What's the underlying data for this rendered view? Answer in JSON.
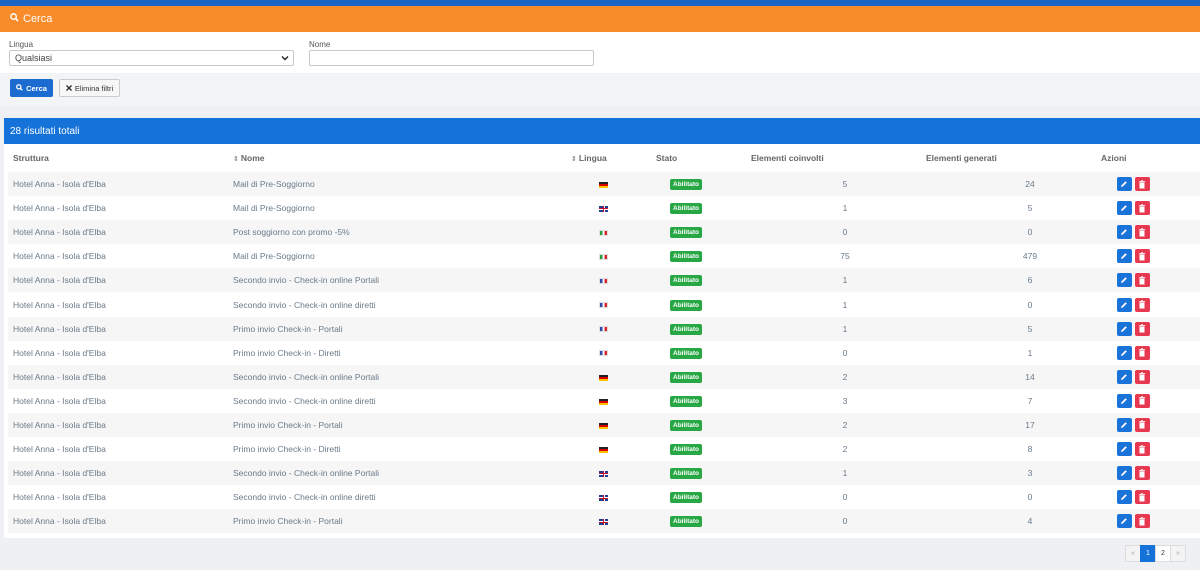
{
  "search": {
    "title": "Cerca",
    "lang_label": "Lingua",
    "lang_value": "Qualsiasi",
    "name_label": "Nome",
    "name_value": "",
    "search_button": "Cerca",
    "clear_button": "Elimina filtri"
  },
  "results": {
    "summary": "28 risultati totali",
    "columns": [
      "Struttura",
      "Nome",
      "Lingua",
      "Stato",
      "Elementi coinvolti",
      "Elementi generati",
      "Azioni"
    ],
    "rows": [
      {
        "struttura": "Hotel Anna - Isola d'Elba",
        "nome": "Mail di Pre-Soggiorno",
        "lingua": "de",
        "stato": "Abilitato",
        "coinvolti": "5",
        "generati": "24"
      },
      {
        "struttura": "Hotel Anna - Isola d'Elba",
        "nome": "Mail di Pre-Soggiorno",
        "lingua": "gb",
        "stato": "Abilitato",
        "coinvolti": "1",
        "generati": "5"
      },
      {
        "struttura": "Hotel Anna - Isola d'Elba",
        "nome": "Post soggiorno con promo -5%",
        "lingua": "it",
        "stato": "Abilitato",
        "coinvolti": "0",
        "generati": "0"
      },
      {
        "struttura": "Hotel Anna - Isola d'Elba",
        "nome": "Mail di Pre-Soggiorno",
        "lingua": "it",
        "stato": "Abilitato",
        "coinvolti": "75",
        "generati": "479"
      },
      {
        "struttura": "Hotel Anna - Isola d'Elba",
        "nome": "Secondo invio - Check-in online Portali",
        "lingua": "fr",
        "stato": "Abilitato",
        "coinvolti": "1",
        "generati": "6"
      },
      {
        "struttura": "Hotel Anna - Isola d'Elba",
        "nome": "Secondo invio - Check-in online diretti",
        "lingua": "fr",
        "stato": "Abilitato",
        "coinvolti": "1",
        "generati": "0"
      },
      {
        "struttura": "Hotel Anna - Isola d'Elba",
        "nome": "Primo invio Check-in - Portali",
        "lingua": "fr",
        "stato": "Abilitato",
        "coinvolti": "1",
        "generati": "5"
      },
      {
        "struttura": "Hotel Anna - Isola d'Elba",
        "nome": "Primo invio Check-in - Diretti",
        "lingua": "fr",
        "stato": "Abilitato",
        "coinvolti": "0",
        "generati": "1"
      },
      {
        "struttura": "Hotel Anna - Isola d'Elba",
        "nome": "Secondo invio - Check-in online Portali",
        "lingua": "de",
        "stato": "Abilitato",
        "coinvolti": "2",
        "generati": "14"
      },
      {
        "struttura": "Hotel Anna - Isola d'Elba",
        "nome": "Secondo invio - Check-in online diretti",
        "lingua": "de",
        "stato": "Abilitato",
        "coinvolti": "3",
        "generati": "7"
      },
      {
        "struttura": "Hotel Anna - Isola d'Elba",
        "nome": "Primo invio Check-in - Portali",
        "lingua": "de",
        "stato": "Abilitato",
        "coinvolti": "2",
        "generati": "17"
      },
      {
        "struttura": "Hotel Anna - Isola d'Elba",
        "nome": "Primo invio Check-in - Diretti",
        "lingua": "de",
        "stato": "Abilitato",
        "coinvolti": "2",
        "generati": "8"
      },
      {
        "struttura": "Hotel Anna - Isola d'Elba",
        "nome": "Secondo invio - Check-in online Portali",
        "lingua": "gb",
        "stato": "Abilitato",
        "coinvolti": "1",
        "generati": "3"
      },
      {
        "struttura": "Hotel Anna - Isola d'Elba",
        "nome": "Secondo invio - Check-in online diretti",
        "lingua": "gb",
        "stato": "Abilitato",
        "coinvolti": "0",
        "generati": "0"
      },
      {
        "struttura": "Hotel Anna - Isola d'Elba",
        "nome": "Primo invio Check-in - Portali",
        "lingua": "gb",
        "stato": "Abilitato",
        "coinvolti": "0",
        "generati": "4"
      }
    ]
  },
  "pagination": {
    "prev": "«",
    "pages": [
      "1",
      "2"
    ],
    "current": "1",
    "next": "»"
  },
  "colors": {
    "header_orange": "#f98c2a",
    "primary_blue": "#1472d9",
    "badge_green": "#28a745",
    "delete_red": "#e8384f"
  }
}
